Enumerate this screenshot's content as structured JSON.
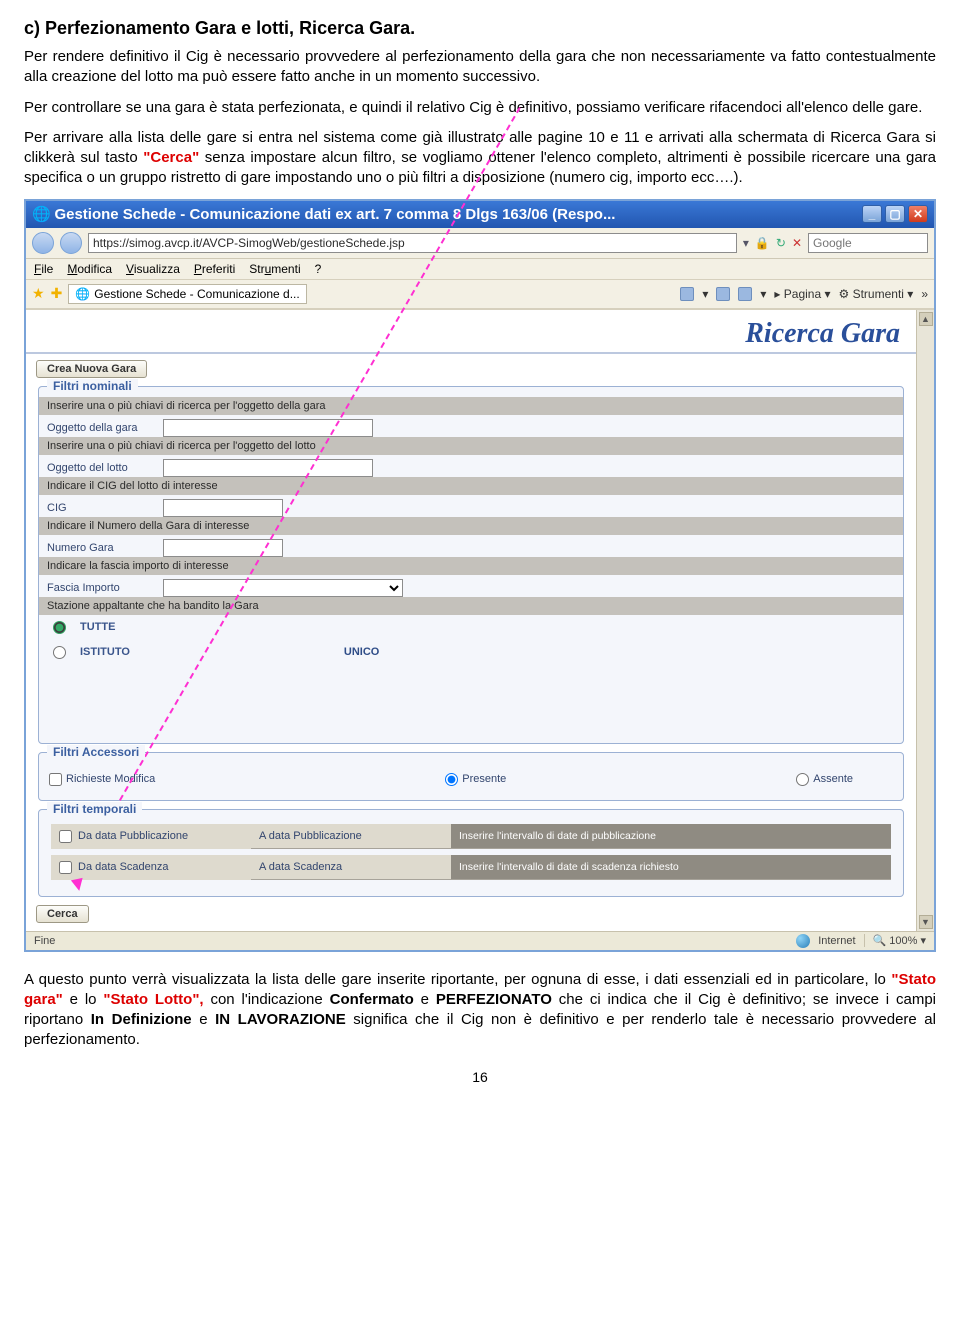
{
  "doc": {
    "heading": "c) Perfezionamento Gara e lotti, Ricerca Gara.",
    "para1": "Per rendere definitivo il Cig è necessario provvedere al perfezionamento della gara che non necessariamente va fatto contestualmente alla creazione del lotto ma può essere fatto anche in un momento successivo.",
    "para2": "Per controllare se una gara è stata perfezionata, e quindi il relativo Cig è definitivo, possiamo verificare rifacendoci all'elenco delle gare.",
    "para3a": "Per arrivare alla lista delle gare si entra nel sistema come già illustrato alle pagine 10 e 11 e arrivati alla schermata di Ricerca Gara si clikkerà sul tasto ",
    "para3_cerca": "\"Cerca\"",
    "para3b": " senza impostare alcun filtro, se vogliamo ottener l'elenco completo, altrimenti è possibile ricercare una gara specifica o un gruppo ristretto di gare impostando uno o più filtri a disposizione (numero cig, importo ecc….).",
    "after1a": "A questo punto verrà visualizzata la lista delle gare inserite riportante, per ognuna di esse, i dati essenziali ed in particolare, lo ",
    "after1_stato_gara": "\"Stato gara\"",
    "after1b": " e lo ",
    "after1_stato_lotto": "\"Stato Lotto\",",
    "after1c": " con l'indicazione ",
    "after1_conf": "Confermato",
    "after1d": " e ",
    "after1_perf": "PERFEZIONATO",
    "after1e": " che ci indica che il Cig è definitivo; se invece i campi riportano ",
    "after1_indef": "In Definizione",
    "after1f": " e ",
    "after1_inlav": "IN LAVORAZIONE",
    "after1g": " significa che il Cig non è definitivo e per renderlo tale è necessario provvedere al perfezionamento.",
    "pagenum": "16"
  },
  "browser": {
    "title": "Gestione Schede - Comunicazione dati ex art. 7 comma 8 Dlgs 163/06 (Respo...",
    "url": "https://simog.avcp.it/AVCP-SimogWeb/gestioneSchede.jsp",
    "search_placeholder": "Google",
    "menu": {
      "file": "File",
      "modifica": "Modifica",
      "visualizza": "Visualizza",
      "preferiti": "Preferiti",
      "strumenti": "Strumenti",
      "help": "?"
    },
    "tab_label": "Gestione Schede - Comunicazione d...",
    "toolbar": {
      "pagina": "Pagina",
      "strumenti": "Strumenti"
    },
    "page_title": "Ricerca Gara",
    "crea_btn": "Crea Nuova Gara",
    "filtri_nominali": {
      "legend": "Filtri nominali",
      "h1": "Inserire una o più chiavi di ricerca per l'oggetto della gara",
      "l1": "Oggetto della gara",
      "h2": "Inserire una o più chiavi di ricerca per l'oggetto del lotto",
      "l2": "Oggetto del lotto",
      "h3": "Indicare il CIG del lotto di interesse",
      "l3": "CIG",
      "h4": "Indicare il Numero della Gara di interesse",
      "l4": "Numero Gara",
      "h5": "Indicare la fascia importo di interesse",
      "l5": "Fascia Importo",
      "h6": "Stazione appaltante che ha bandito la Gara",
      "r1": "TUTTE",
      "r2": "ISTITUTO",
      "unico": "UNICO"
    },
    "filtri_accessori": {
      "legend": "Filtri Accessori",
      "chk": "Richieste Modifica",
      "opt1": "Presente",
      "opt2": "Assente"
    },
    "filtri_temporali": {
      "legend": "Filtri temporali",
      "da_pub": "Da data Pubblicazione",
      "a_pub": "A data Pubblicazione",
      "hint_pub": "Inserire l'intervallo di date di pubblicazione",
      "da_scad": "Da data Scadenza",
      "a_scad": "A data Scadenza",
      "hint_scad": "Inserire l'intervallo di date di scadenza richiesto"
    },
    "cerca_btn": "Cerca",
    "status": {
      "left": "Fine",
      "zone": "Internet",
      "zoom": "100%"
    }
  }
}
